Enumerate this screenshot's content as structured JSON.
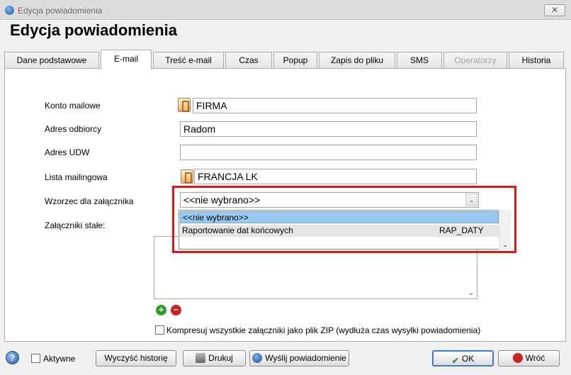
{
  "window": {
    "title": "Edycja powiadomienia",
    "close_glyph": "✕"
  },
  "page_title": "Edycja powiadomienia",
  "tabs": [
    {
      "label": "Dane podstawowe"
    },
    {
      "label": "E-mail"
    },
    {
      "label": "Treść e-mail"
    },
    {
      "label": "Czas"
    },
    {
      "label": "Popup"
    },
    {
      "label": "Zapis do pliku"
    },
    {
      "label": "SMS"
    },
    {
      "label": "Operatorzy"
    },
    {
      "label": "Historia"
    }
  ],
  "form": {
    "konto_label": "Konto mailowe",
    "konto_value": "FIRMA",
    "odbiorca_label": "Adres odbiorcy",
    "odbiorca_value": "Radom",
    "udw_label": "Adres UDW",
    "udw_value": "",
    "lista_label": "Lista mailingowa",
    "lista_value": "FRANCJA LK",
    "wzorzec_label": "Wzorzec dla załącznika",
    "wzorzec_value": "<<nie wybrano>>",
    "zalaczniki_label": "Załączniki stałe:",
    "dropdown": [
      {
        "name": "<<nie wybrano>>",
        "code": ""
      },
      {
        "name": "Raportowanie dat końcowych",
        "code": "RAP_DATY"
      }
    ],
    "zip_label": "Kompresuj wszystkie załączniki jako plik ZIP (wydłuża czas wysyłki powiadomienia)"
  },
  "footer": {
    "help_glyph": "?",
    "active_label": "Aktywne",
    "clear_history_label": "Wyczyść historię",
    "print_label": "Drukuj",
    "send_label": "Wyślij powiadomienie",
    "ok_label": "OK",
    "back_label": "Wróć"
  },
  "icons": {
    "add": "+",
    "remove": "−",
    "chevron": "⌄"
  },
  "colors": {
    "highlight": "#e2161a",
    "selected_row": "#99c9ef",
    "add": "#2f9d27",
    "remove": "#d0201e"
  }
}
